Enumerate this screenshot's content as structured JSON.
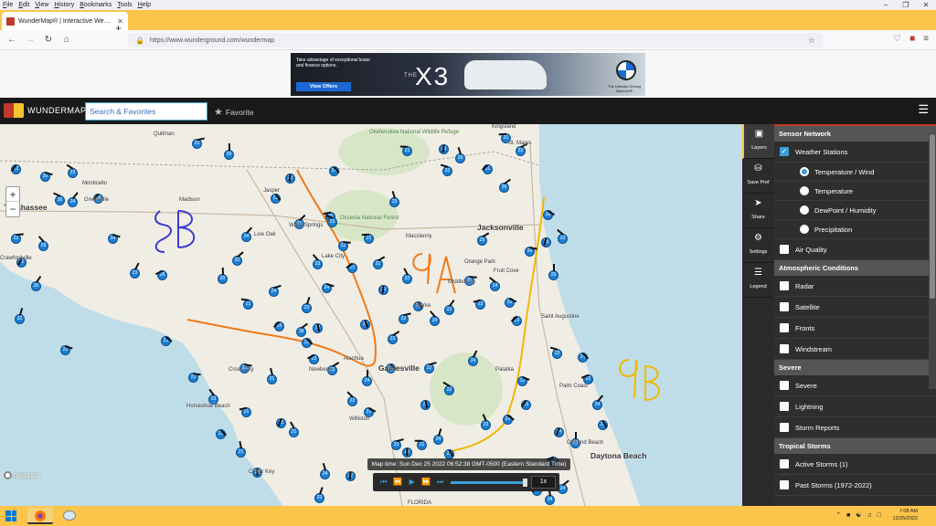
{
  "menu": {
    "items": [
      "File",
      "Edit",
      "View",
      "History",
      "Bookmarks",
      "Tools",
      "Help"
    ]
  },
  "browser": {
    "tab_title": "WunderMap® | Interactive We…",
    "url": "https://www.wunderground.com/wundermap",
    "new_tab_icon": "plus-icon"
  },
  "ad": {
    "text": "Take advantage of exceptional lease and finance options.",
    "button": "View Offers",
    "the": "THE",
    "model": "X3",
    "tagline": "The Ultimate Driving Machine®"
  },
  "header": {
    "brand": "WUNDERMAP",
    "search_value": "Search & Favorites",
    "favorite_label": "Favorite",
    "colors": {
      "brand_red": "#c0392b",
      "brand_yellow": "#f4c430",
      "brand_blue": "#3aa0d8",
      "header_bg": "#1a1a1a"
    }
  },
  "map": {
    "labels": [
      {
        "text": "Tallahassee"
      },
      {
        "text": "Monticello"
      },
      {
        "text": "Greenville"
      },
      {
        "text": "Madison"
      },
      {
        "text": "Quitman"
      },
      {
        "text": "Jasper"
      },
      {
        "text": "Live Oak"
      },
      {
        "text": "White Springs"
      },
      {
        "text": "Lake City"
      },
      {
        "text": "Okefenokee National Wildlife Refuge"
      },
      {
        "text": "Osceola National Forest"
      },
      {
        "text": "Kingsland"
      },
      {
        "text": "St. Marys"
      },
      {
        "text": "Jacksonville"
      },
      {
        "text": "Macclenny"
      },
      {
        "text": "Orange Park"
      },
      {
        "text": "Fruit Cove"
      },
      {
        "text": "Middleburg"
      },
      {
        "text": "Starke"
      },
      {
        "text": "Saint Augustine"
      },
      {
        "text": "Alachua"
      },
      {
        "text": "Gainesville"
      },
      {
        "text": "Newberry"
      },
      {
        "text": "Cross City"
      },
      {
        "text": "Palatka"
      },
      {
        "text": "Palm Coast"
      },
      {
        "text": "Ormond Beach"
      },
      {
        "text": "Daytona Beach"
      },
      {
        "text": "Williston"
      },
      {
        "text": "Crawfordville"
      },
      {
        "text": "Horseshoe Beach"
      },
      {
        "text": "Cedar Key"
      },
      {
        "text": "FLORIDA"
      }
    ],
    "annotations": [
      {
        "text": "8B",
        "color": "#3b3bd6"
      },
      {
        "text": "9A",
        "color": "#f07a1a"
      },
      {
        "text": "9B",
        "color": "#f2b800"
      }
    ],
    "zoom_in": "+",
    "zoom_out": "−",
    "attribution": "mapbox",
    "time_label": "Map time: Sun Dec 25 2022 06:52:38 GMT-0500 (Eastern Standard Time)",
    "speed": "1x"
  },
  "sidetabs": [
    {
      "label": "Layers",
      "icon": "layers-icon"
    },
    {
      "label": "Save Pref",
      "icon": "save-icon"
    },
    {
      "label": "Share",
      "icon": "share-icon"
    },
    {
      "label": "Settings",
      "icon": "gear-icon"
    },
    {
      "label": "Legend",
      "icon": "list-icon"
    }
  ],
  "panel": {
    "sensor_network": "Sensor Network",
    "weather_stations": "Weather Stations",
    "temp_wind": "Temperature / Wind",
    "temperature": "Temperature",
    "dewpoint": "DewPoint / Humidity",
    "precipitation": "Precipitation",
    "air_quality": "Air Quality",
    "atmospheric": "Atmospheric Conditions",
    "radar": "Radar",
    "satellite": "Satellite",
    "fronts": "Fronts",
    "windstream": "Windstream",
    "severe_header": "Severe",
    "severe": "Severe",
    "lightning": "Lightning",
    "storm_reports": "Storm Reports",
    "tropical": "Tropical Storms",
    "active_storms": "Active Storms (1)",
    "past_storms": "Past Storms (1972-2022)"
  },
  "taskbar": {
    "time": "7:08 AM",
    "date": "12/25/2022"
  }
}
